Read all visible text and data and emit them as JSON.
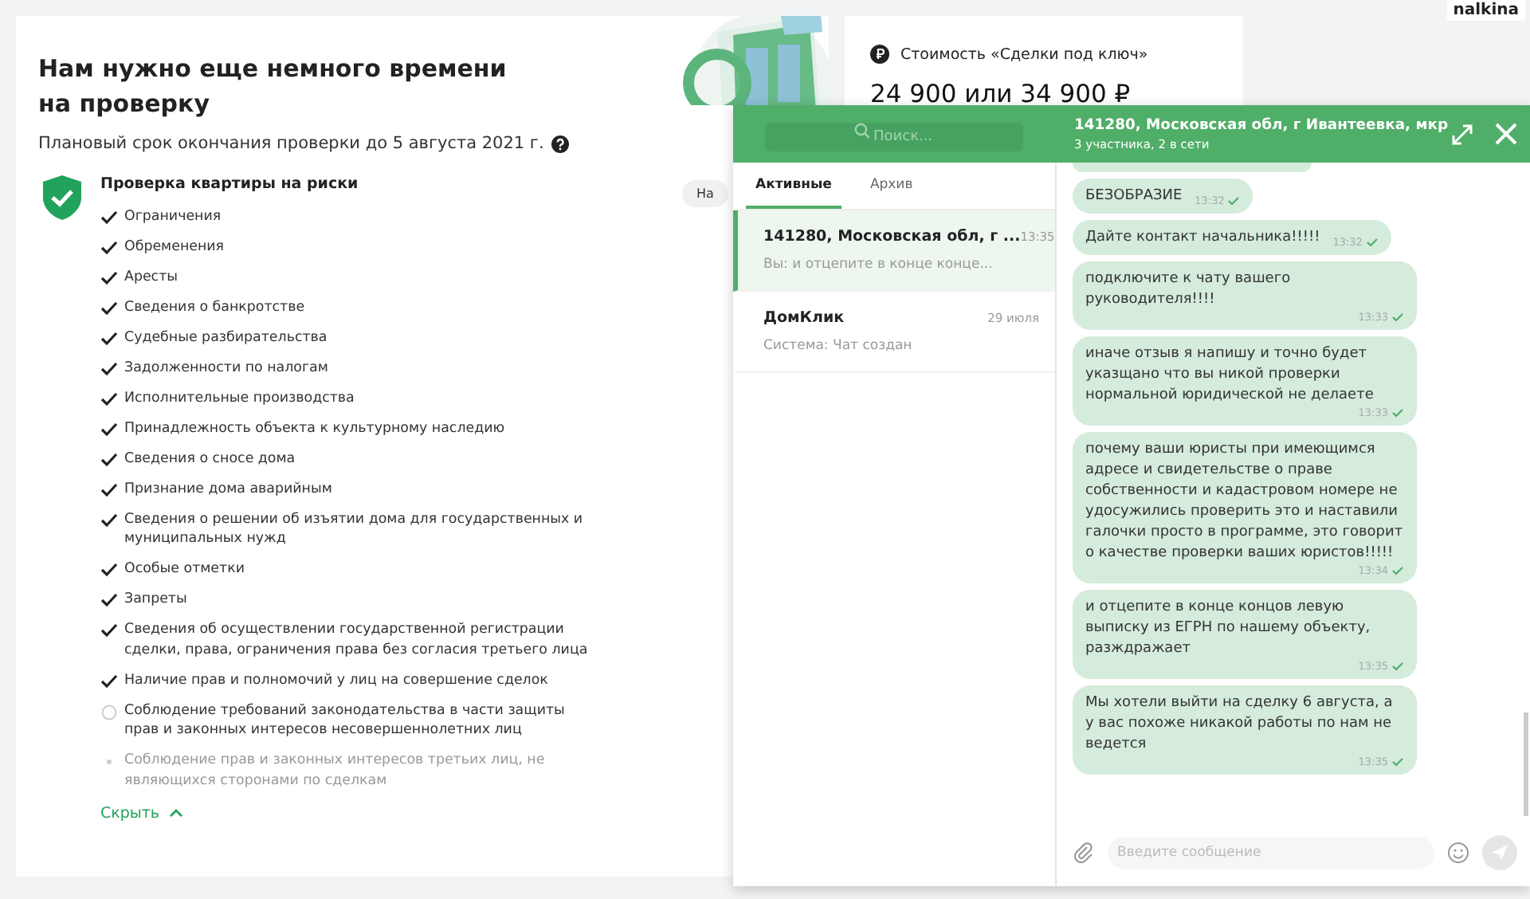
{
  "user": {
    "name": "nalkina"
  },
  "review": {
    "title": "Нам нужно еще немного времени на проверку",
    "subtitle": "Плановый срок окончания проверки до 5 августа 2021 г.",
    "status_badge": "На",
    "checklist": {
      "title": "Проверка квартиры на риски",
      "items": [
        {
          "label": "Ограничения",
          "kind": "check"
        },
        {
          "label": "Обременения",
          "kind": "check"
        },
        {
          "label": "Аресты",
          "kind": "check"
        },
        {
          "label": "Сведения о банкротстве",
          "kind": "check"
        },
        {
          "label": "Судебные разбирательства",
          "kind": "check"
        },
        {
          "label": "Задолженности по налогам",
          "kind": "check"
        },
        {
          "label": "Исполнительные производства",
          "kind": "check"
        },
        {
          "label": "Принадлежность объекта к культурному наследию",
          "kind": "check"
        },
        {
          "label": "Сведения о сносе дома",
          "kind": "check"
        },
        {
          "label": "Признание дома аварийным",
          "kind": "check"
        },
        {
          "label": "Сведения о решении об изъятии дома для государственных и муниципальных нужд",
          "kind": "check"
        },
        {
          "label": "Особые отметки",
          "kind": "check"
        },
        {
          "label": "Запреты",
          "kind": "check"
        },
        {
          "label": "Сведения об осуществлении государственной регистрации сделки, права, ограничения права без согласия третьего лица",
          "kind": "check"
        },
        {
          "label": "Наличие прав и полномочий у лиц на совершение сделок",
          "kind": "check"
        },
        {
          "label": "Соблюдение требований законодательства в части защиты прав и законных интересов несовершеннолетних лиц",
          "kind": "spinner"
        },
        {
          "label": "Соблюдение прав и законных интересов третьих лиц, не являющихся сторонами по сделкам",
          "kind": "dot"
        }
      ],
      "toggle": "Скрыть"
    }
  },
  "price": {
    "title": "Стоимость «Сделки под ключ»",
    "value": "24 900 или 34 900 ₽"
  },
  "chat": {
    "search": {
      "placeholder": "Поиск..."
    },
    "tabs": [
      {
        "label": "Активные",
        "selected": true
      },
      {
        "label": "Архив",
        "selected": false
      }
    ],
    "conversations": [
      {
        "title": "141280, Московская обл, г ...",
        "time": "13:35",
        "preview": "Вы: и отцепите в конце конце...",
        "selected": true
      },
      {
        "title": "ДомКлик",
        "time": "29 июля",
        "preview": "Система: Чат создан",
        "selected": false
      }
    ],
    "header": {
      "title": "141280, Московская обл, г Ивантеевка, мкр",
      "subtitle": "3 участника, 2 в сети"
    },
    "messages": [
      {
        "text": "БЕЗОБРАЗИЕ",
        "time": "13:32"
      },
      {
        "text": "Дайте контакт начальника!!!!!",
        "time": "13:32"
      },
      {
        "text": "подключите к чату вашего руководителя!!!!",
        "time": "13:33"
      },
      {
        "text": "иначе отзыв я напишу и точно будет указщано что вы никой проверки нормальной юридической не делаете",
        "time": "13:33"
      },
      {
        "text": "почему ваши юристы при имеющимся адресе и свидетельстве о праве собственности и кадастровом номере не удосужились проверить это и наставили галочки просто в программе, это говорит о качестве проверки ваших юристов!!!!!",
        "time": "13:34"
      },
      {
        "text": "и отцепите в конце концов левую выписку из ЕГРН по нашему объекту, разждражает",
        "time": "13:35"
      },
      {
        "text": "Мы хотели выйти на сделку 6 августа, а у вас похоже никакой работы по нам не ведется",
        "time": "13:35"
      }
    ],
    "composer": {
      "placeholder": "Введите сообщение"
    }
  }
}
